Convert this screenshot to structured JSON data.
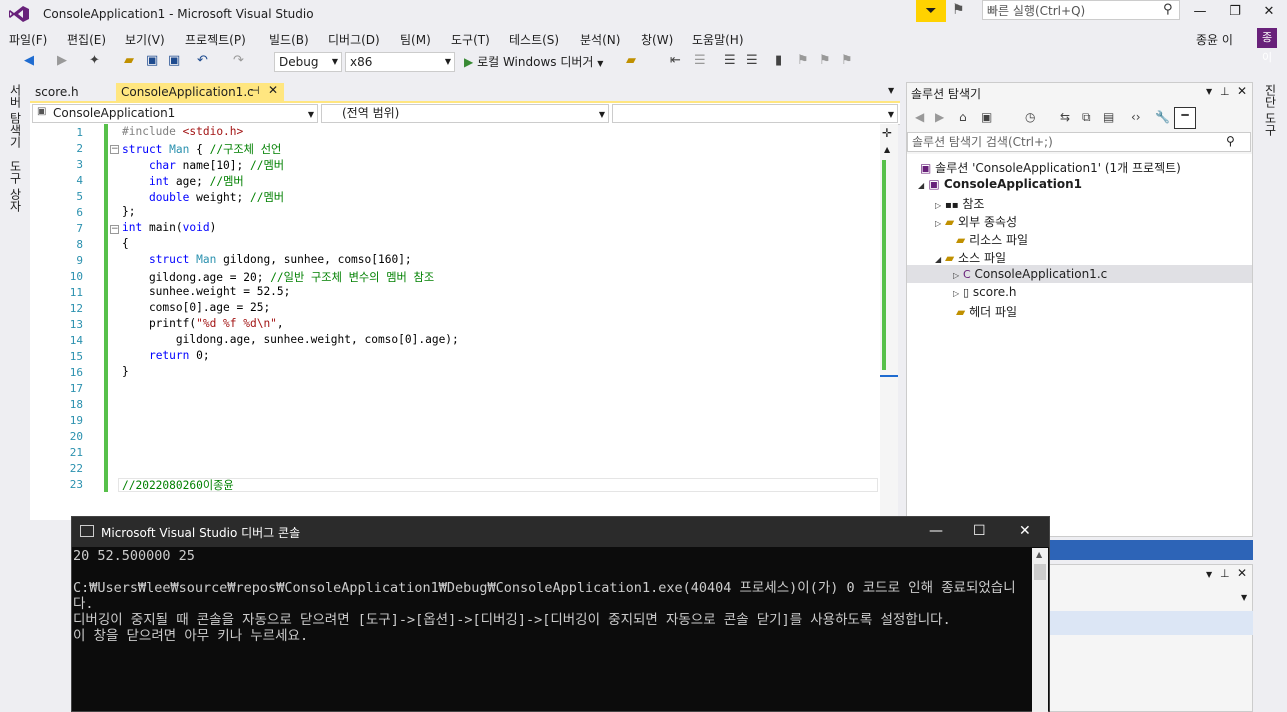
{
  "window": {
    "title": "ConsoleApplication1 - Microsoft Visual Studio",
    "quick_launch_placeholder": "빠른 실행(Ctrl+Q)",
    "minimize": "—",
    "restore": "❐",
    "close": "✕",
    "user_name": "종윤 이",
    "user_avatar": "종이"
  },
  "menu": [
    "파일(F)",
    "편집(E)",
    "보기(V)",
    "프로젝트(P)",
    "빌드(B)",
    "디버그(D)",
    "팀(M)",
    "도구(T)",
    "테스트(S)",
    "분석(N)",
    "창(W)",
    "도움말(H)"
  ],
  "toolbar": {
    "config": "Debug",
    "platform": "x86",
    "run_label": "로컬 Windows 디버거"
  },
  "left_tabs": [
    "서버 탐색기",
    "도구 상자"
  ],
  "right_tab": "진단 도구",
  "doc_tabs": {
    "inactive": "score.h",
    "active": "ConsoleApplication1.c",
    "pin": "⊣",
    "close": "✕"
  },
  "navbar": {
    "project": "ConsoleApplication1",
    "scope": "(전역 범위)",
    "member": ""
  },
  "editor": {
    "line_numbers": [
      "1",
      "2",
      "3",
      "4",
      "5",
      "6",
      "7",
      "8",
      "9",
      "10",
      "11",
      "12",
      "13",
      "14",
      "15",
      "16",
      "17",
      "18",
      "19",
      "20",
      "21",
      "22",
      "23"
    ],
    "lines": [
      "#include <stdio.h>",
      "struct Man { //구조체 선언",
      "    char name[10]; //멤버",
      "    int age; //멤버",
      "    double weight; //멤버",
      "};",
      "int main(void)",
      "{",
      "    struct Man gildong, sunhee, comso[160];",
      "    gildong.age = 20; //일반 구조체 변수의 멤버 참조",
      "    sunhee.weight = 52.5;",
      "    comso[0].age = 25;",
      "    printf(\"%d %f %d\\n\",",
      "        gildong.age, sunhee.weight, comso[0].age);",
      "    return 0;",
      "}",
      "",
      "",
      "",
      "",
      "",
      "",
      "//2022080260이종윤"
    ]
  },
  "solution_explorer": {
    "title": "솔루션 탐색기",
    "search_placeholder": "솔루션 탐색기 검색(Ctrl+;)",
    "solution": "솔루션 'ConsoleApplication1' (1개 프로젝트)",
    "project": "ConsoleApplication1",
    "references": "참조",
    "external_deps": "외부 종속성",
    "resource_files": "리소스 파일",
    "source_files": "소스 파일",
    "source_c": "ConsoleApplication1.c",
    "source_h": "score.h",
    "header_files": "헤더 파일"
  },
  "console": {
    "title": "Microsoft Visual Studio 디버그 콘솔",
    "output": "20 52.500000 25\n\nC:₩Users₩lee₩source₩repos₩ConsoleApplication1₩Debug₩ConsoleApplication1.exe(40404 프로세스)이(가) 0 코드로 인해 종료되었습니다.\n디버깅이 중지될 때 콘솔을 자동으로 닫으려면 [도구]->[옵션]->[디버깅]->[디버깅이 중지되면 자동으로 콘솔 닫기]를 사용하도록 설정합니다.\n이 창을 닫으려면 아무 키나 누르세요."
  },
  "colors": {
    "accent": "#68217a",
    "active_tab": "#ffe680",
    "change_bar": "#57c04a"
  }
}
